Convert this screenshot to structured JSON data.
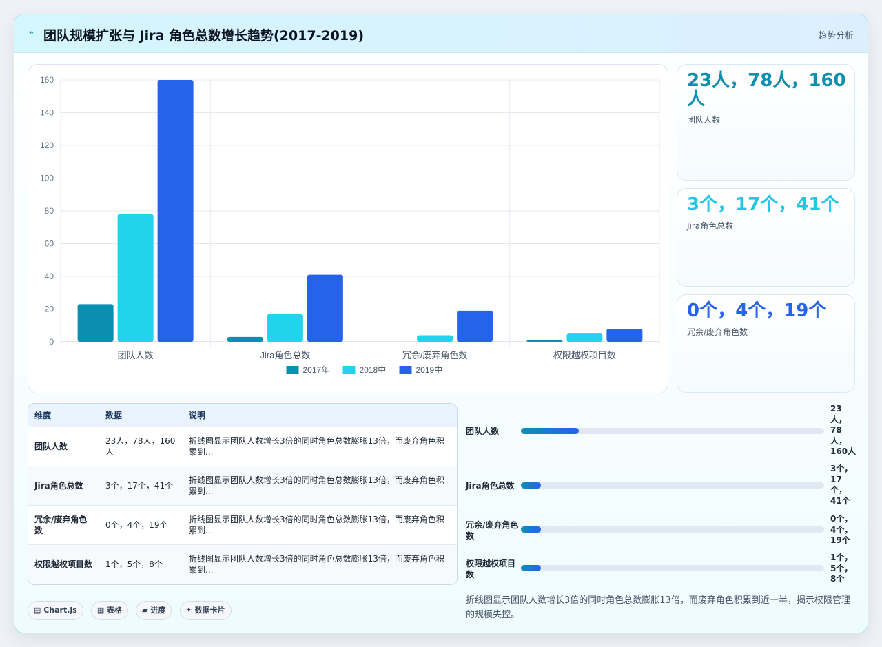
{
  "header": {
    "title": "团队规模扩张与 Jira 角色总数增长趋势(2017-2019)",
    "tag": "趋势分析"
  },
  "chart_data": {
    "type": "bar",
    "categories": [
      "团队人数",
      "Jira角色总数",
      "冗余/废弃角色数",
      "权限越权项目数"
    ],
    "series": [
      {
        "name": "2017年",
        "color": "#0a8fb0",
        "values": [
          23,
          3,
          0,
          1
        ]
      },
      {
        "name": "2018中",
        "color": "#22d3ee",
        "values": [
          78,
          17,
          4,
          5
        ]
      },
      {
        "name": "2019中",
        "color": "#2563eb",
        "values": [
          160,
          41,
          19,
          8
        ]
      }
    ],
    "ylim": [
      0,
      160
    ],
    "yticks": [
      0,
      20,
      40,
      60,
      80,
      100,
      120,
      140,
      160
    ],
    "grid": true,
    "legend": "bottom"
  },
  "kpis": [
    {
      "value": "23人，78人，160人",
      "label": "团队人数",
      "color": "#0e8fb0"
    },
    {
      "value": "3个，17个，41个",
      "label": "Jira角色总数",
      "color": "#22c7e6"
    },
    {
      "value": "0个，4个，19个",
      "label": "冗余/废弃角色数",
      "color": "#2563eb"
    }
  ],
  "table": {
    "headers": [
      "维度",
      "数据",
      "说明"
    ],
    "rows": [
      {
        "dim": "团队人数",
        "data": "23人，78人，160人",
        "desc": "折线图显示团队人数增长3倍的同时角色总数膨胀13倍，而废弃角色积累到..."
      },
      {
        "dim": "Jira角色总数",
        "data": "3个，17个，41个",
        "desc": "折线图显示团队人数增长3倍的同时角色总数膨胀13倍，而废弃角色积累到..."
      },
      {
        "dim": "冗余/废弃角色数",
        "data": "0个，4个，19个",
        "desc": "折线图显示团队人数增长3倍的同时角色总数膨胀13倍，而废弃角色积累到..."
      },
      {
        "dim": "权限越权项目数",
        "data": "1个，5个，8个",
        "desc": "折线图显示团队人数增长3倍的同时角色总数膨胀13倍，而废弃角色积累到..."
      }
    ]
  },
  "progress": [
    {
      "label": "团队人数",
      "value": "23人，78人，160人",
      "fraction": 0.19
    },
    {
      "label": "Jira角色总数",
      "value": "3个，17个，41个",
      "fraction": 0.065
    },
    {
      "label": "冗余/废弃角色数",
      "value": "0个，4个，19个",
      "fraction": 0.065
    },
    {
      "label": "权限越权项目数",
      "value": "1个，5个，8个",
      "fraction": 0.065
    }
  ],
  "chips": [
    "▤ Chart.js",
    "▦ 表格",
    "▰ 进度",
    "✦ 数据卡片"
  ],
  "note": "折线图显示团队人数增长3倍的同时角色总数膨胀13倍，而废弃角色积累到近一半，揭示权限管理的规模失控。"
}
